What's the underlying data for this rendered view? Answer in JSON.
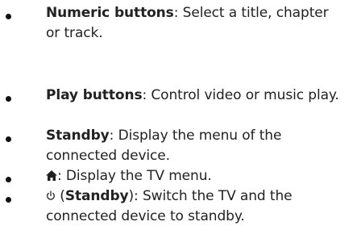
{
  "items": [
    {
      "term": "Numeric buttons",
      "desc": ": Select a title, chapter or track."
    },
    {
      "term": "Play buttons",
      "desc": ": Control video or music play."
    },
    {
      "term": "Standby",
      "desc": ": Display the menu of the connected device."
    },
    {
      "icon": "home-icon",
      "desc": ": Display the TV menu."
    },
    {
      "icon": "power-icon",
      "pre": " (",
      "term": "Standby",
      "desc": "): Switch the TV and the connected device to standby."
    }
  ]
}
